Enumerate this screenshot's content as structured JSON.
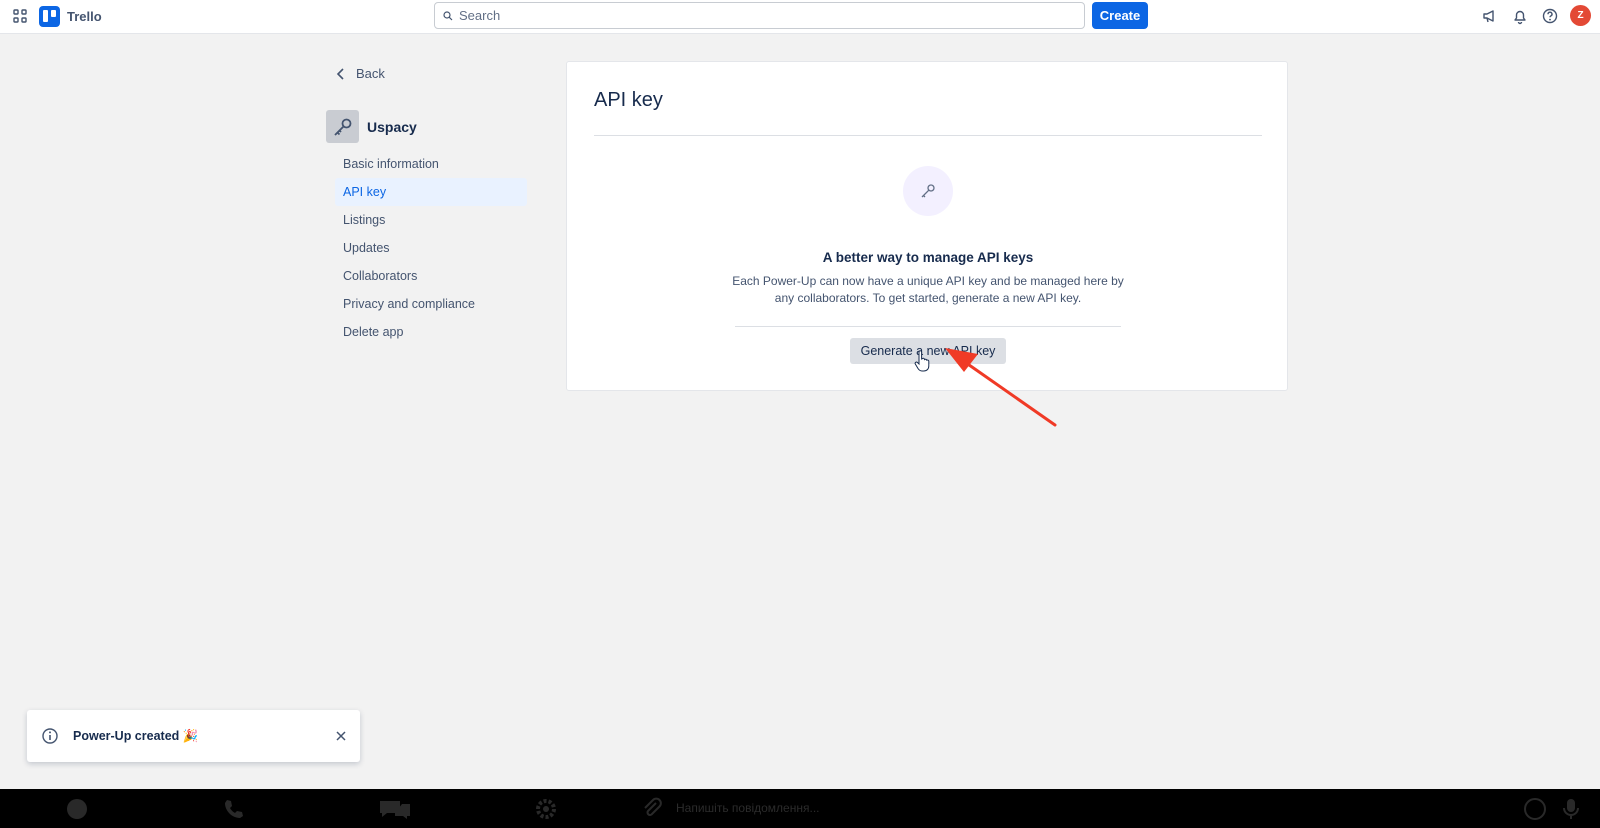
{
  "header": {
    "app_name": "Trello",
    "search_placeholder": "Search",
    "create_label": "Create",
    "avatar_initial": "Z",
    "icons": [
      "apps-grid-icon",
      "megaphone-icon",
      "bell-icon",
      "help-icon"
    ]
  },
  "sidebar": {
    "back_label": "Back",
    "app_name": "Uspacy",
    "items": [
      {
        "label": "Basic information",
        "active": false
      },
      {
        "label": "API key",
        "active": true
      },
      {
        "label": "Listings",
        "active": false
      },
      {
        "label": "Updates",
        "active": false
      },
      {
        "label": "Collaborators",
        "active": false
      },
      {
        "label": "Privacy and compliance",
        "active": false
      },
      {
        "label": "Delete app",
        "active": false
      }
    ]
  },
  "main": {
    "title": "API key",
    "empty_title": "A better way to manage API keys",
    "empty_desc": "Each Power-Up can now have a unique API key and be managed here by any collaborators. To get started, generate a new API key.",
    "generate_label": "Generate a new API key"
  },
  "toast": {
    "text": "Power-Up created 🎉"
  },
  "bottom_bar": {
    "message_placeholder": "Напишіть повідомлення..."
  },
  "colors": {
    "brand": "#0c66e4",
    "annotation_arrow": "#f03a26",
    "avatar": "#e34935"
  }
}
